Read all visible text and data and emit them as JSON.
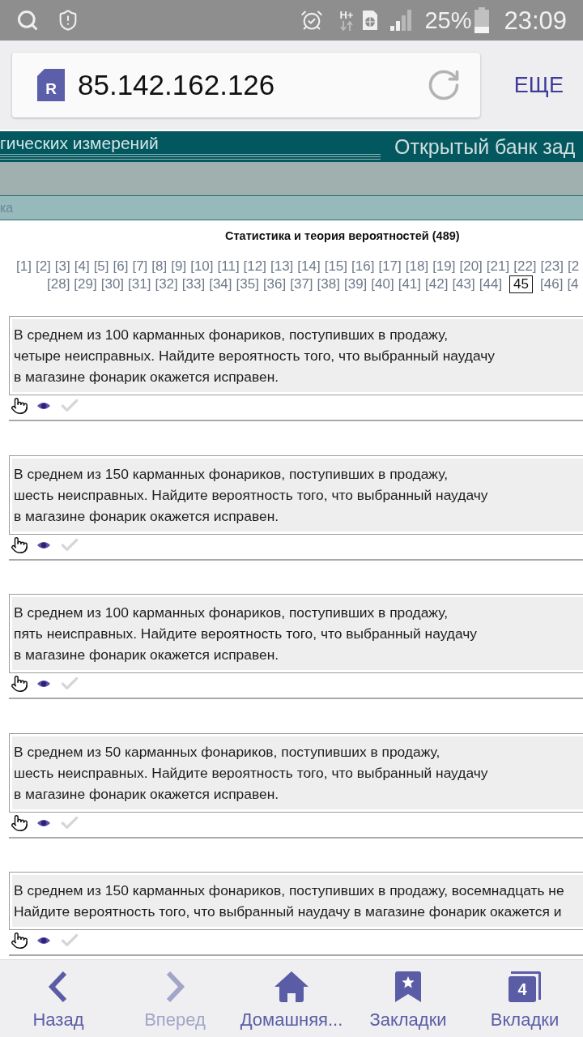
{
  "status_bar": {
    "network_type": "H+",
    "battery": "25%",
    "time": "23:09"
  },
  "browser": {
    "favicon_letter": "R",
    "url": "85.142.162.126",
    "menu_label": "ЕЩЕ"
  },
  "site_header": {
    "subtitle": "гических измерений",
    "title": "Открытый банк зад",
    "nav_text": "ка"
  },
  "section_title": "Статистика и теория вероятностей (489)",
  "pagination": {
    "first_line": [
      {
        "label": "[1]",
        "selected": false
      },
      {
        "label": "[2]",
        "selected": false
      },
      {
        "label": "[3]",
        "selected": false
      },
      {
        "label": "[4]",
        "selected": false
      },
      {
        "label": "[5]",
        "selected": false
      },
      {
        "label": "[6]",
        "selected": false
      },
      {
        "label": "[7]",
        "selected": false
      },
      {
        "label": "[8]",
        "selected": false
      },
      {
        "label": "[9]",
        "selected": false
      },
      {
        "label": "[10]",
        "selected": false
      },
      {
        "label": "[11]",
        "selected": false
      },
      {
        "label": "[12]",
        "selected": false
      },
      {
        "label": "[13]",
        "selected": false
      },
      {
        "label": "[14]",
        "selected": false
      },
      {
        "label": "[15]",
        "selected": false
      },
      {
        "label": "[16]",
        "selected": false
      },
      {
        "label": "[17]",
        "selected": false
      },
      {
        "label": "[18]",
        "selected": false
      },
      {
        "label": "[19]",
        "selected": false
      },
      {
        "label": "[20]",
        "selected": false
      },
      {
        "label": "[21]",
        "selected": false
      },
      {
        "label": "[22]",
        "selected": false
      },
      {
        "label": "[23]",
        "selected": false
      },
      {
        "label": "[2",
        "selected": false
      }
    ],
    "second_line": [
      {
        "label": "[28]",
        "selected": false
      },
      {
        "label": "[29]",
        "selected": false
      },
      {
        "label": "[30]",
        "selected": false
      },
      {
        "label": "[31]",
        "selected": false
      },
      {
        "label": "[32]",
        "selected": false
      },
      {
        "label": "[33]",
        "selected": false
      },
      {
        "label": "[34]",
        "selected": false
      },
      {
        "label": "[35]",
        "selected": false
      },
      {
        "label": "[36]",
        "selected": false
      },
      {
        "label": "[37]",
        "selected": false
      },
      {
        "label": "[38]",
        "selected": false
      },
      {
        "label": "[39]",
        "selected": false
      },
      {
        "label": "[40]",
        "selected": false
      },
      {
        "label": "[41]",
        "selected": false
      },
      {
        "label": "[42]",
        "selected": false
      },
      {
        "label": "[43]",
        "selected": false
      },
      {
        "label": "[44]",
        "selected": false
      },
      {
        "label": "45",
        "selected": true
      },
      {
        "label": "[46]",
        "selected": false
      },
      {
        "label": "[4",
        "selected": false
      }
    ]
  },
  "problems": [
    {
      "lines": [
        "В среднем из 100 карманных фонариков, поступивших в продажу,",
        "четыре неисправных. Найдите вероятность того, что выбранный наудачу",
        "в магазине фонарик окажется исправен."
      ]
    },
    {
      "lines": [
        "В среднем из 150 карманных фонариков, поступивших в продажу,",
        "шесть неисправных. Найдите вероятность того, что выбранный наудачу",
        "в магазине фонарик окажется исправен."
      ]
    },
    {
      "lines": [
        "В среднем из 100 карманных фонариков, поступивших в продажу,",
        "пять неисправных. Найдите вероятность того, что выбранный наудачу",
        "в магазине фонарик окажется исправен."
      ]
    },
    {
      "lines": [
        "В среднем из 50 карманных фонариков, поступивших в продажу,",
        "шесть неисправных. Найдите вероятность того, что выбранный наудачу",
        "в магазине фонарик окажется исправен."
      ]
    },
    {
      "lines": [
        "В среднем из 150 карманных фонариков, поступивших в продажу, восемнадцать не",
        "Найдите вероятность того, что выбранный наудачу в магазине фонарик окажется и"
      ]
    }
  ],
  "bottom_nav": [
    {
      "kind": "back",
      "label": "Назад",
      "disabled": false
    },
    {
      "kind": "forward",
      "label": "Вперед",
      "disabled": true
    },
    {
      "kind": "home",
      "label": "Домашняя...",
      "disabled": false
    },
    {
      "kind": "bookmarks",
      "label": "Закладки",
      "disabled": false
    },
    {
      "kind": "tabs",
      "label": "Вкладки",
      "count": "4",
      "disabled": false
    }
  ]
}
